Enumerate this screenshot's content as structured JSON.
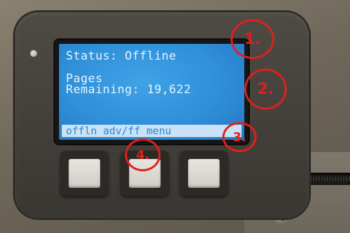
{
  "lcd": {
    "status_line": "Status: Offline",
    "pages_label": "Pages",
    "remaining_line": "Remaining: 19,622",
    "softkeys": "offln adv/ff menu"
  },
  "markers": [
    "1.",
    "2.",
    "3.",
    "4."
  ],
  "colors": {
    "lcd_blue": "#2f8fd9",
    "marker_red": "#e0201a"
  }
}
